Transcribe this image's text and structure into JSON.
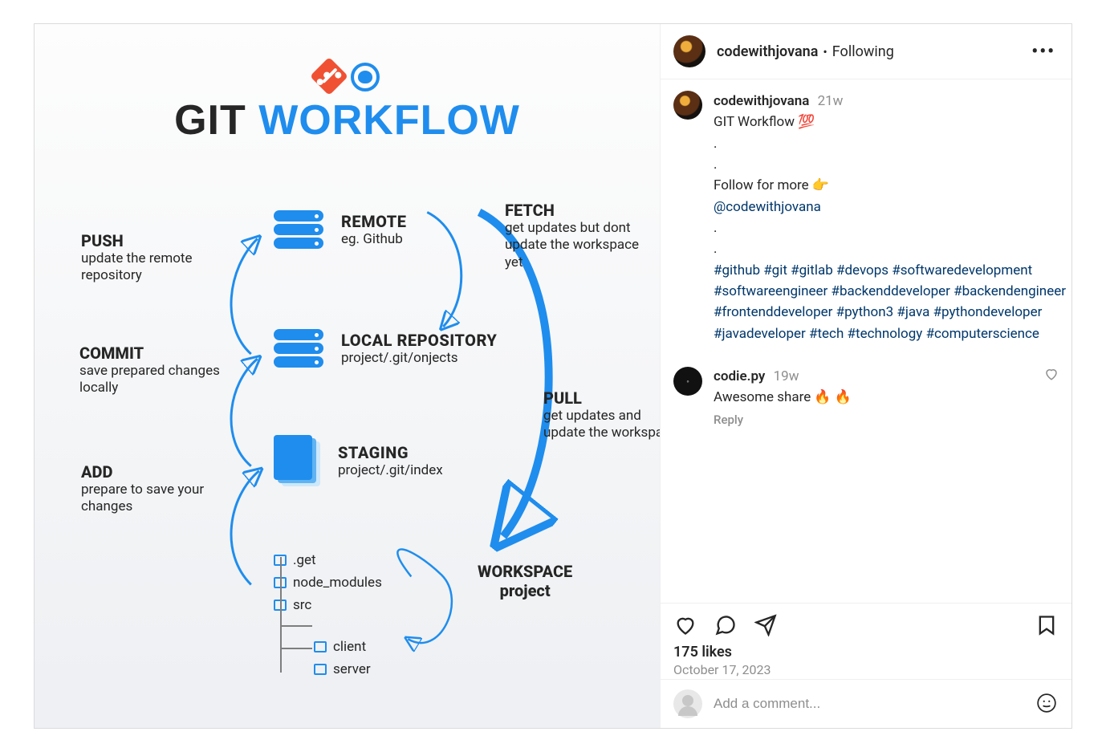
{
  "header": {
    "username": "codewithjovana",
    "status": "Following",
    "dot": "•"
  },
  "caption": {
    "username": "codewithjovana",
    "timestamp": "21w",
    "title_line": "GIT Workflow 💯",
    "spacer": ".",
    "follow_line": "Follow for more 👉",
    "mention": "@codewithjovana",
    "hashtags": "#github #git #gitlab #devops #softwaredevelopment #softwareengineer #backenddeveloper #backendengineer #frontenddeveloper #python3 #java #pythondeveloper #javadeveloper #tech #technology #computerscience"
  },
  "comment": {
    "username": "codie.py",
    "timestamp": "19w",
    "text": "Awesome share 🔥 🔥",
    "reply_label": "Reply"
  },
  "stats": {
    "likes": "175 likes",
    "date": "October 17, 2023"
  },
  "input": {
    "placeholder": "Add a comment..."
  },
  "diagram": {
    "title_black": "GIT ",
    "title_blue": "WORKFLOW",
    "remote": {
      "title": "REMOTE",
      "sub": "eg. Github"
    },
    "local": {
      "title": "LOCAL REPOSITORY",
      "sub": "project/.git/onjects"
    },
    "staging": {
      "title": "STAGING",
      "sub": "project/.git/index"
    },
    "workspace": {
      "title": "WORKSPACE",
      "sub": "project"
    },
    "push": {
      "title": "PUSH",
      "desc": "update the remote repository"
    },
    "commit": {
      "title": "COMMIT",
      "desc": "save prepared changes locally"
    },
    "add": {
      "title": "ADD",
      "desc": "prepare to save your changes"
    },
    "fetch": {
      "title": "FETCH",
      "desc": "get updates but dont update the workspace yet"
    },
    "pull": {
      "title": "PULL",
      "desc": "get updates and update the workspace"
    },
    "tree": {
      "f0": ".get",
      "f1": "node_modules",
      "f2": "src",
      "f3": "client",
      "f4": "server"
    }
  }
}
